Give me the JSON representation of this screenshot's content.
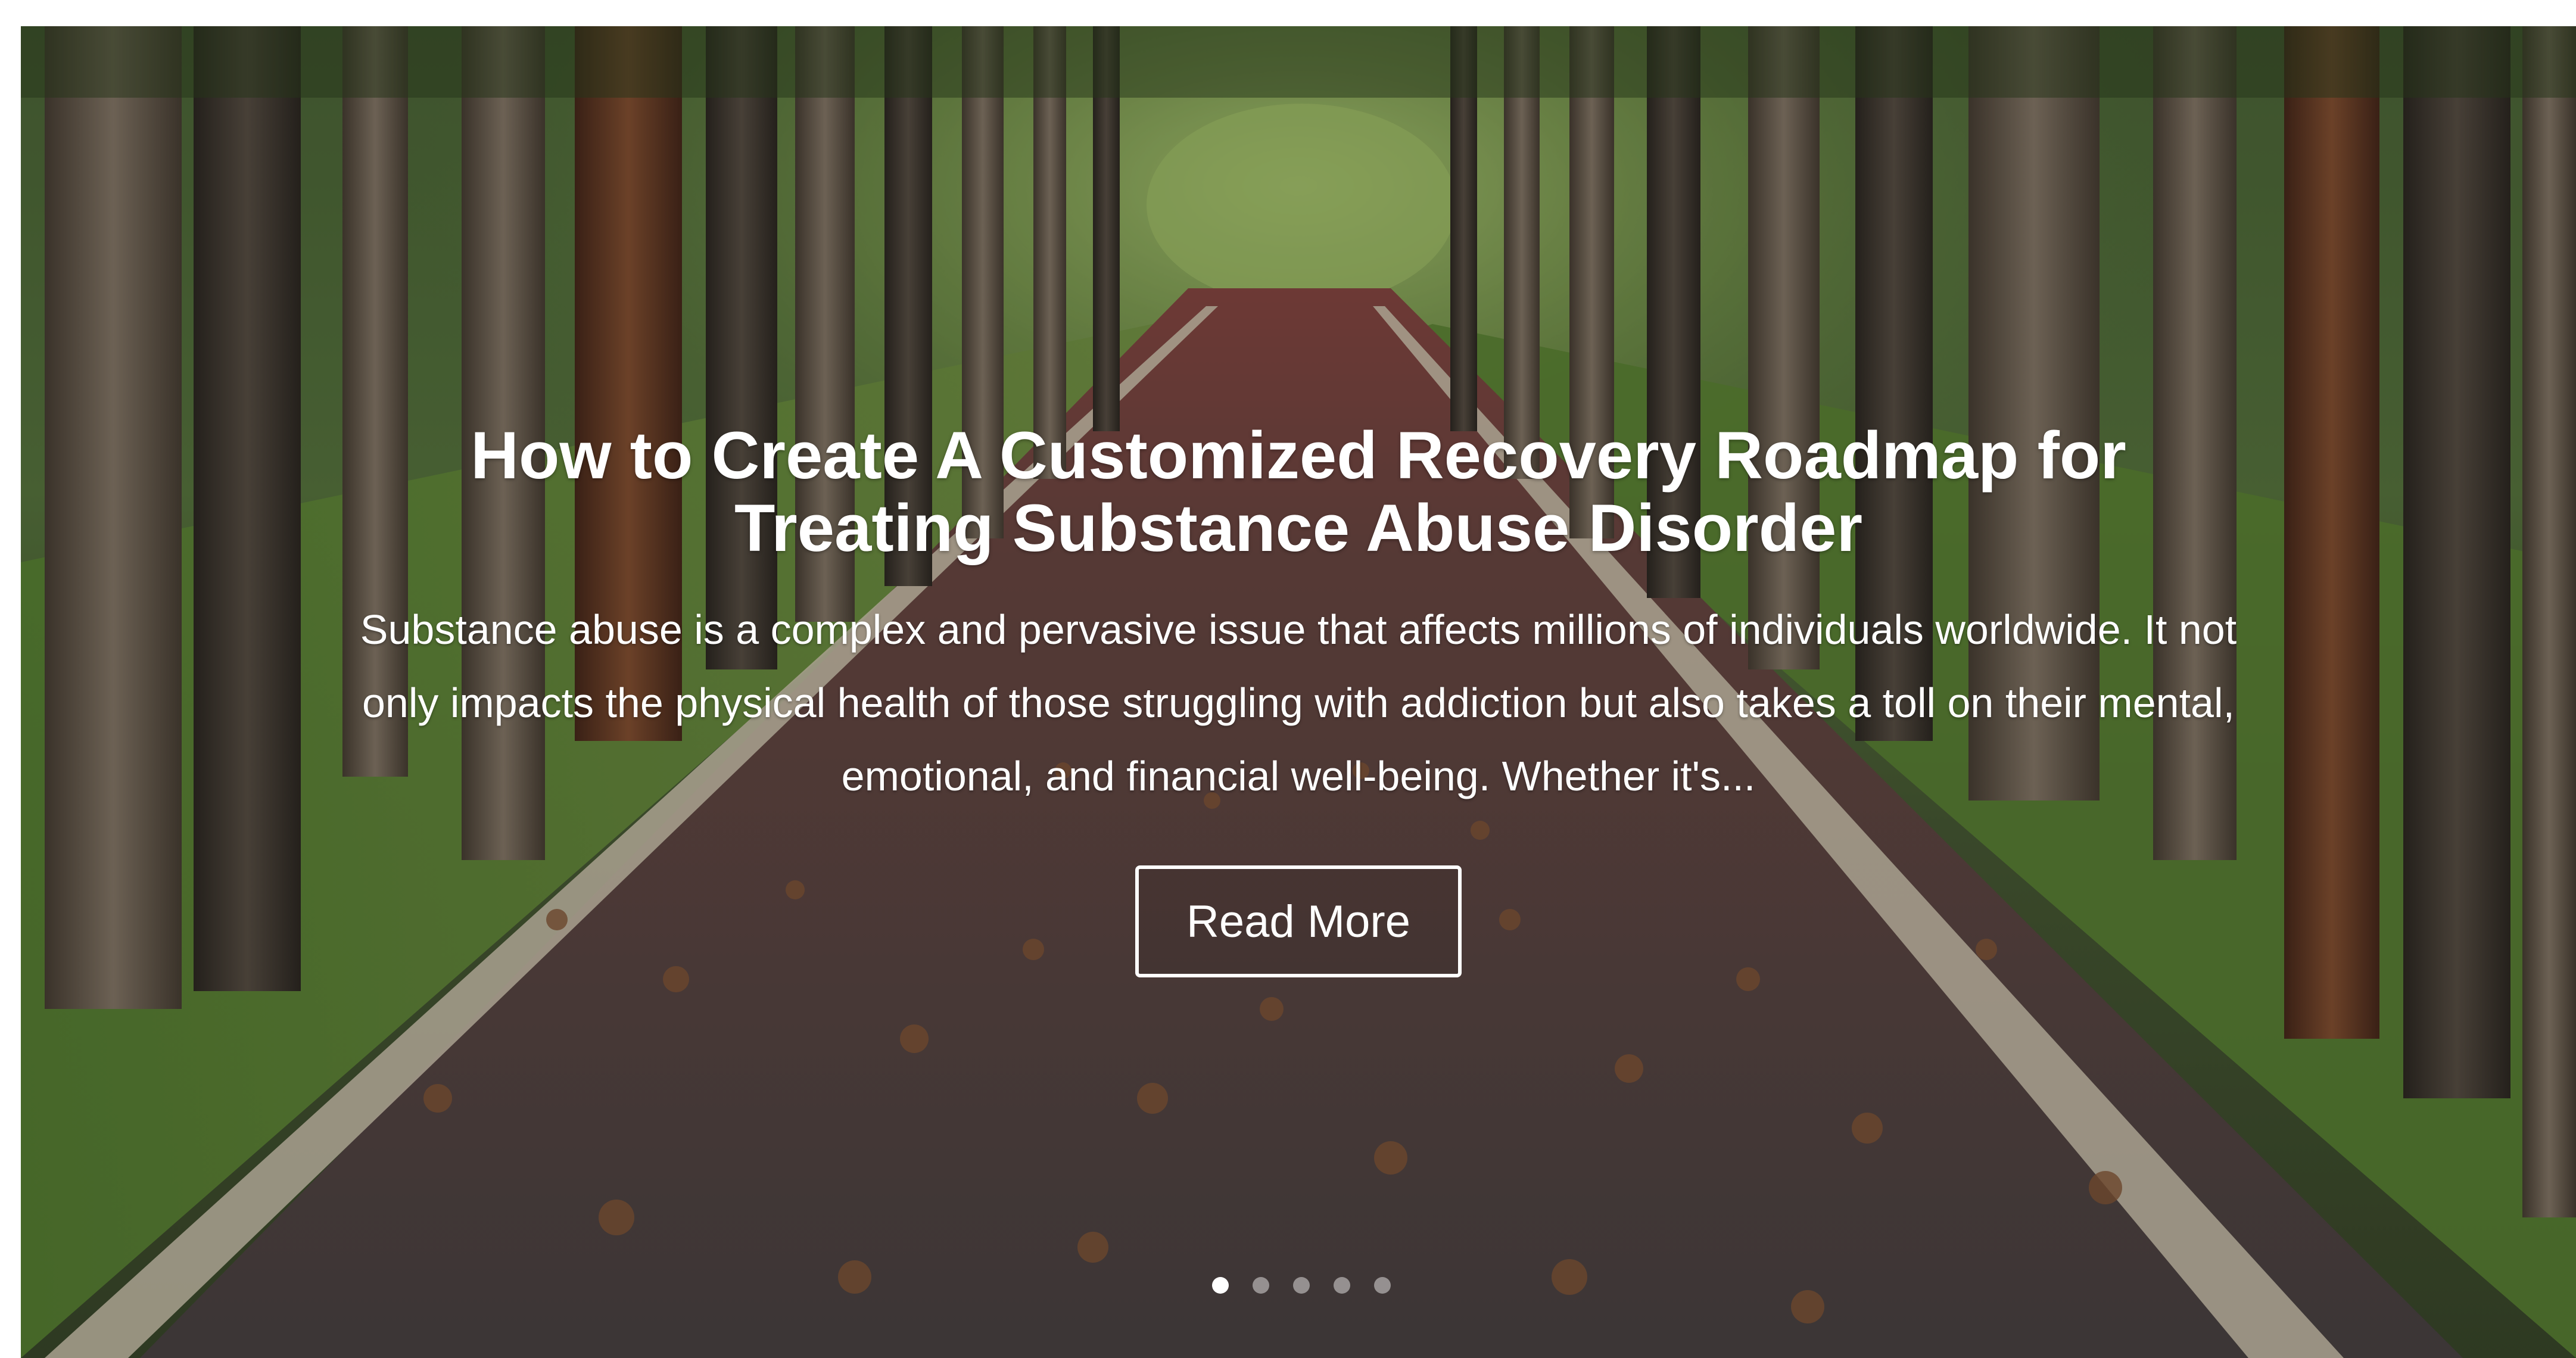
{
  "slide": {
    "title": "How to Create A Customized Recovery Roadmap for Treating Substance Abuse Disorder",
    "excerpt": "Substance abuse is a complex and pervasive issue that affects millions of individuals worldwide. It not only impacts the physical health of those struggling with addiction but also takes a toll on their mental, emotional, and financial well-being. Whether it's...",
    "button_label": "Read More",
    "background_image": "tree-lined-road-with-fallen-leaves"
  },
  "pagination": {
    "count": 5,
    "active_index": 0
  },
  "colors": {
    "text": "#ffffff",
    "button_border": "#ffffff",
    "dot_active": "#ffffff",
    "dot_inactive": "#ffffff73"
  }
}
